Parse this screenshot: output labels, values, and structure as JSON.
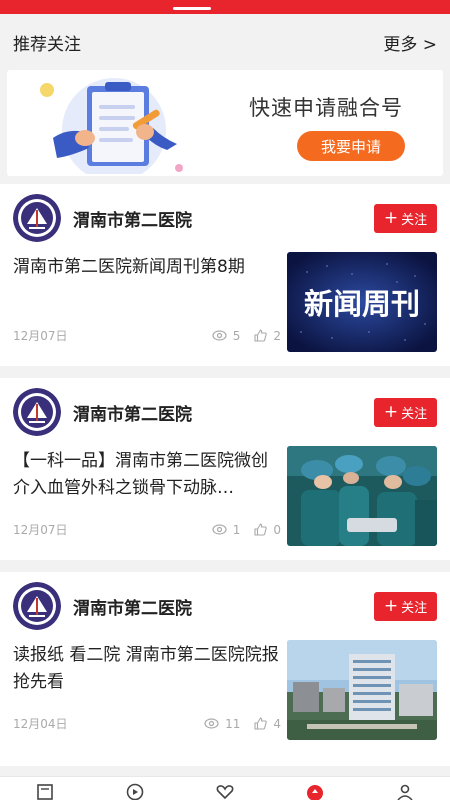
{
  "section": {
    "title": "推荐关注",
    "more_label": "更多 >"
  },
  "banner": {
    "title": "快速申请融合号",
    "button_label": "我要申请"
  },
  "colors": {
    "brand_red": "#e8242c",
    "banner_orange": "#f46a1e"
  },
  "posts": [
    {
      "source": "渭南市第二医院",
      "follow_label": "关注",
      "headline": "渭南市第二医院新闻周刊第8期",
      "date": "12月07日",
      "views": "5",
      "likes": "2",
      "thumb_text": "新闻周刊"
    },
    {
      "source": "渭南市第二医院",
      "follow_label": "关注",
      "headline": "【一科一品】渭南市第二医院微创介入血管外科之锁骨下动脉…",
      "date": "12月07日",
      "views": "1",
      "likes": "0"
    },
    {
      "source": "渭南市第二医院",
      "follow_label": "关注",
      "headline": "读报纸 看二院 渭南市第二医院院报抢先看",
      "date": "12月04日",
      "views": "11",
      "likes": "4"
    }
  ],
  "tabbar": {
    "icons": [
      "news-icon",
      "play-icon",
      "heart-icon",
      "center-icon",
      "person-icon"
    ]
  }
}
